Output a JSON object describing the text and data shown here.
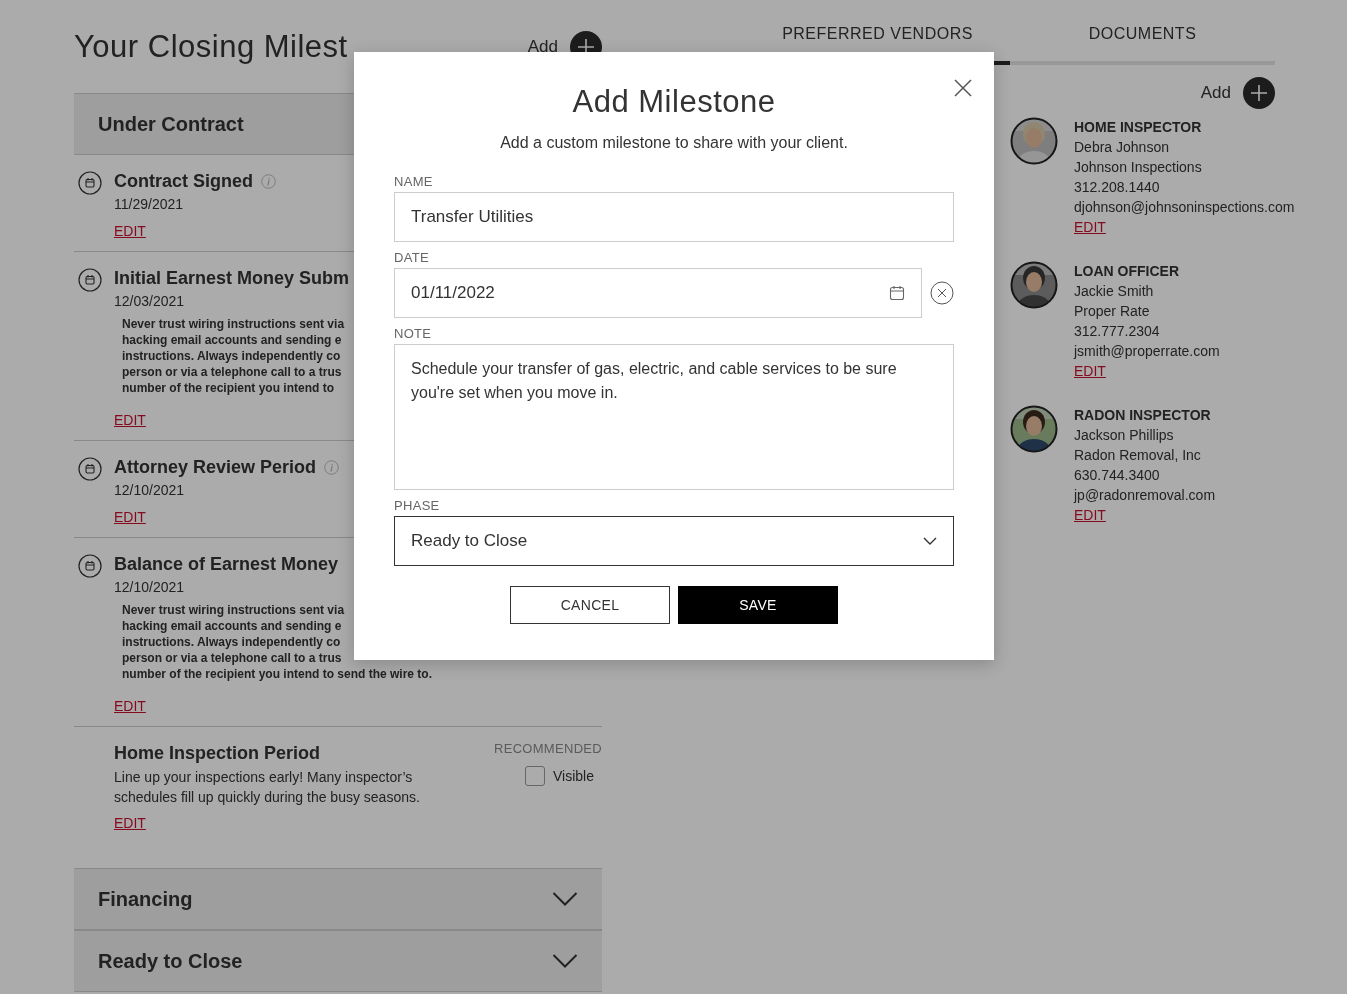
{
  "page_title": "Your Closing Milest",
  "header_add": {
    "label": "Add"
  },
  "sections": [
    {
      "title": "Under Contract",
      "expanded": true,
      "milestones": [
        {
          "kind": "dated",
          "title": "Contract Signed",
          "info": true,
          "date": "11/29/2021",
          "edit": "EDIT"
        },
        {
          "kind": "dated",
          "title": "Initial Earnest Money Subm",
          "info": false,
          "date": "12/03/2021",
          "warning_lines": [
            "Never trust wiring instructions sent via",
            "hacking email accounts and sending e",
            "instructions. Always independently co",
            "person or via a telephone call to a trus",
            "number of the recipient you intend to"
          ],
          "edit": "EDIT"
        },
        {
          "kind": "dated",
          "title": "Attorney Review Period",
          "info": true,
          "date": "12/10/2021",
          "edit": "EDIT"
        },
        {
          "kind": "dated",
          "title": "Balance of Earnest Money",
          "info": false,
          "date": "12/10/2021",
          "warning_lines": [
            "Never trust wiring instructions sent via",
            "hacking email accounts and sending e",
            "instructions. Always independently co",
            "person or via a telephone call to a trus",
            "number of the recipient you intend to send the wire to."
          ],
          "edit": "EDIT"
        },
        {
          "kind": "recommended",
          "title": "Home Inspection Period",
          "description": "Line up your inspections early! Many inspector’s schedules fill up quickly during the busy seasons.",
          "tag": "RECOMMENDED",
          "visible_label": "Visible",
          "checked": false,
          "edit": "EDIT"
        }
      ]
    },
    {
      "title": "Financing",
      "expanded": false
    },
    {
      "title": "Ready to Close",
      "expanded": false
    }
  ],
  "tabs": [
    {
      "label": "PREFERRED VENDORS",
      "selected": true
    },
    {
      "label": "DOCUMENTS",
      "selected": false
    }
  ],
  "vendor_add": {
    "label": "Add"
  },
  "vendors": [
    {
      "kind": "picture",
      "role": "HOME INSPECTOR",
      "name": "Debra Johnson",
      "company": "Johnson Inspections",
      "phone": "312.208.1440",
      "email": "djohnson@johnsoninspections.com",
      "edit": "EDIT"
    },
    {
      "kind": "picture",
      "role": "LOAN OFFICER",
      "name": "Jackie Smith",
      "company": "Proper Rate",
      "phone": "312.777.2304",
      "email": "jsmith@properrate.com",
      "edit": "EDIT"
    },
    {
      "kind": "picture",
      "role": "RADON INSPECTOR",
      "name": "Jackson Phillips",
      "company": "Radon Removal, Inc",
      "phone": "630.744.3400",
      "email": "jp@radonremoval.com",
      "edit": "EDIT"
    }
  ],
  "modal": {
    "title": "Add Milestone",
    "subtitle": "Add a custom milestone to share with your client.",
    "fields": [
      {
        "kind": "text",
        "label": "NAME",
        "value": "Transfer Utilities"
      },
      {
        "kind": "date",
        "label": "DATE",
        "value": "01/11/2022"
      },
      {
        "kind": "textarea",
        "label": "NOTE",
        "value": "Schedule your transfer of gas, electric, and cable services to be sure you're set when you move in."
      },
      {
        "kind": "select",
        "label": "PHASE",
        "value": "Ready to Close"
      }
    ],
    "buttons": [
      {
        "kind": "secondary",
        "label": "CANCEL"
      },
      {
        "kind": "primary",
        "label": "SAVE"
      }
    ]
  }
}
